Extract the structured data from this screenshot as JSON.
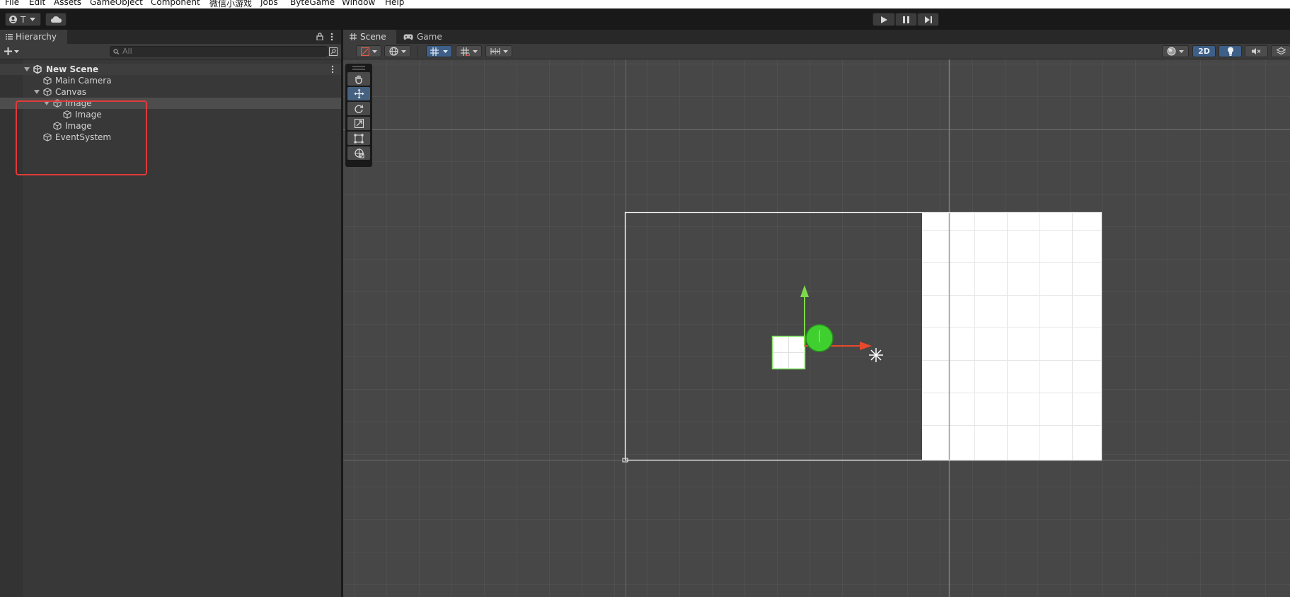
{
  "menu": [
    "File",
    "Edit",
    "Assets",
    "GameObject",
    "Component",
    "微信小游戏",
    "Jobs",
    "ByteGame",
    "Window",
    "Help"
  ],
  "toolbar": {
    "account_label": "T",
    "play_icon": "play-icon",
    "pause_icon": "pause-icon",
    "step_icon": "step-icon"
  },
  "hierarchy": {
    "tab_label": "Hierarchy",
    "search_placeholder": "All",
    "scene_name": "New Scene",
    "items": [
      {
        "label": "Main Camera",
        "depth": 1,
        "expanded": null
      },
      {
        "label": "Canvas",
        "depth": 1,
        "expanded": true
      },
      {
        "label": "Image",
        "depth": 2,
        "expanded": true,
        "selected": true
      },
      {
        "label": "Image",
        "depth": 3,
        "expanded": null
      },
      {
        "label": "Image",
        "depth": 2,
        "expanded": null
      },
      {
        "label": "EventSystem",
        "depth": 1,
        "expanded": null
      }
    ]
  },
  "scene_view": {
    "tabs": [
      "Scene",
      "Game"
    ],
    "active_tab": "Scene",
    "mode_2d_label": "2D"
  },
  "colors": {
    "highlight_box": "#e03a3a",
    "axis_y": "#7dd94a",
    "axis_x": "#e8492c",
    "handle_circle": "#3fcf2e",
    "toggle_on": "#3e5f88"
  }
}
